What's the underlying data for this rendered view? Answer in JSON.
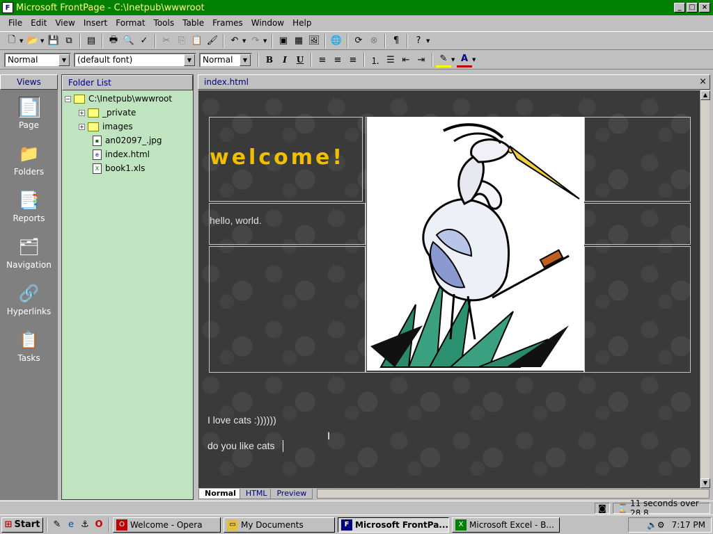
{
  "titlebar": {
    "title": "Microsoft FrontPage - C:\\Inetpub\\wwwroot",
    "min": "_",
    "max": "□",
    "close": "×"
  },
  "menu": [
    "File",
    "Edit",
    "View",
    "Insert",
    "Format",
    "Tools",
    "Table",
    "Frames",
    "Window",
    "Help"
  ],
  "formatting": {
    "style": "Normal",
    "font": "(default font)",
    "size": "Normal",
    "bold": "B",
    "italic": "I",
    "underline": "U"
  },
  "views": {
    "header": "Views",
    "items": [
      "Page",
      "Folders",
      "Reports",
      "Navigation",
      "Hyperlinks",
      "Tasks"
    ]
  },
  "folder_list": {
    "header": "Folder List",
    "root": "C:\\Inetpub\\wwwroot",
    "items": [
      "_private",
      "images",
      "an02097_.jpg",
      "index.html",
      "book1.xls"
    ]
  },
  "editor": {
    "tab_title": "index.html",
    "close": "×",
    "welcome": "welcome!",
    "hello": "hello, world.",
    "line1": "I love cats :))))))",
    "line2": "do you like cats",
    "view_tabs": [
      "Normal",
      "HTML",
      "Preview"
    ]
  },
  "status": {
    "download_time": "11 seconds over 28.8"
  },
  "taskbar": {
    "start": "Start",
    "tasks": [
      "Welcome - Opera",
      "My Documents",
      "Microsoft FrontPa...",
      "Microsoft Excel - B..."
    ],
    "clock": "7:17 PM"
  },
  "colors": {
    "titlebar": "#008000",
    "folder_bg": "#c0e4c0",
    "welcome_text": "#f0c000"
  }
}
